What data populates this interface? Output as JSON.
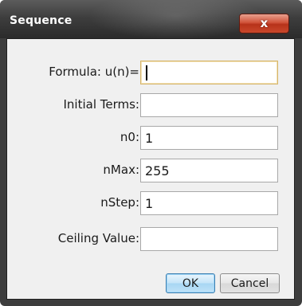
{
  "dialog": {
    "title": "Sequence",
    "close_label": "x"
  },
  "fields": [
    {
      "label": "Formula: u(n)=",
      "value": ""
    },
    {
      "label": "Initial Terms:",
      "value": ""
    },
    {
      "label": "n0:",
      "value": "1"
    },
    {
      "label": "nMax:",
      "value": "255"
    },
    {
      "label": "nStep:",
      "value": "1"
    },
    {
      "label": "Ceiling Value:",
      "value": ""
    }
  ],
  "buttons": {
    "ok_label": "OK",
    "cancel_label": "Cancel"
  }
}
